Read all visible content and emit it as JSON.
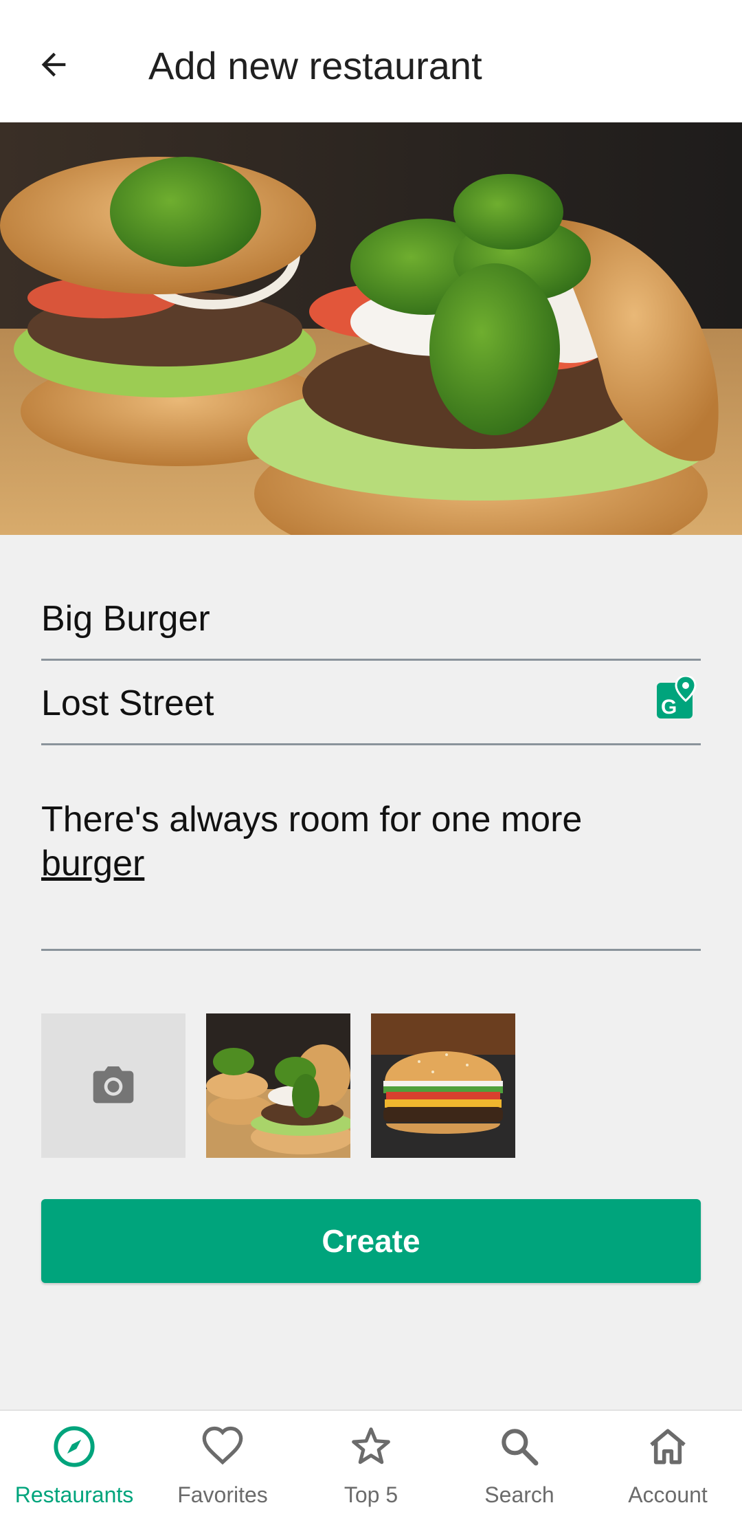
{
  "header": {
    "title": "Add new restaurant",
    "back_icon": "arrow-back-icon"
  },
  "hero": {
    "image": "burger-photo"
  },
  "form": {
    "name_value": "Big Burger",
    "address_value": "Lost Street",
    "address_icon": "google-maps-icon",
    "description_line1": "There's always room for one more",
    "description_line2": "burger"
  },
  "photos": {
    "add_icon": "camera-icon",
    "thumbnails": [
      "burger-basil-photo",
      "cheeseburger-photo"
    ]
  },
  "actions": {
    "create_label": "Create"
  },
  "bottom_nav": {
    "items": [
      {
        "label": "Restaurants",
        "icon": "compass-icon",
        "active": true
      },
      {
        "label": "Favorites",
        "icon": "heart-icon",
        "active": false
      },
      {
        "label": "Top 5",
        "icon": "star-icon",
        "active": false
      },
      {
        "label": "Search",
        "icon": "search-icon",
        "active": false
      },
      {
        "label": "Account",
        "icon": "home-icon",
        "active": false
      }
    ]
  },
  "colors": {
    "accent": "#00a47c",
    "background": "#f0f0f0",
    "inactive_nav": "#6b6b6b"
  }
}
